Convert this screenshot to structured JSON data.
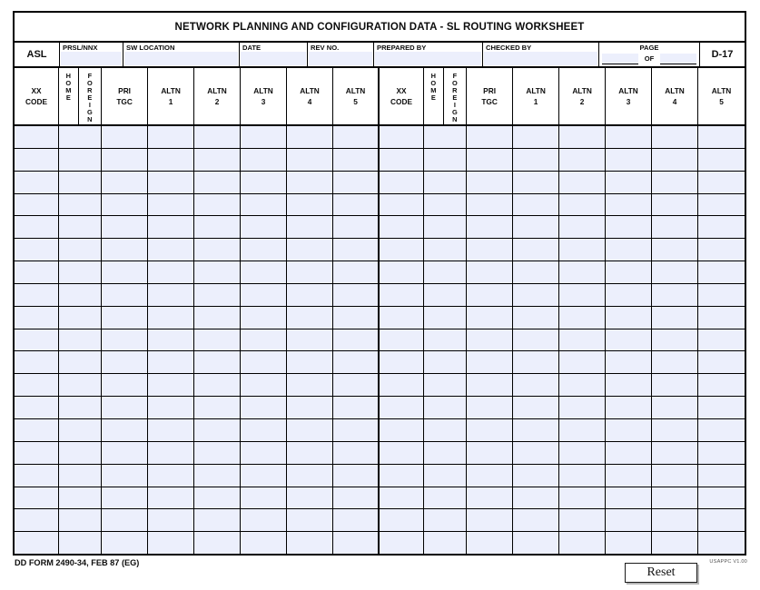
{
  "document": {
    "title": "NETWORK PLANNING AND CONFIGURATION DATA - SL ROUTING WORKSHEET",
    "form_id": "DD FORM 2490-34, FEB 87 (EG)",
    "agency_version": "USAPPC V1.00",
    "page_ref": "D-17"
  },
  "meta": {
    "asl_label": "ASL",
    "prsl_label": "PRSL/NNX",
    "sw_location_label": "SW LOCATION",
    "date_label": "DATE",
    "rev_no_label": "REV NO.",
    "prepared_by_label": "PREPARED BY",
    "checked_by_label": "CHECKED BY",
    "page_label": "PAGE",
    "of_label": "OF",
    "values": {
      "prsl": "",
      "sw_location": "",
      "date": "",
      "rev_no": "",
      "prepared_by": "",
      "checked_by": "",
      "page": "",
      "of": ""
    }
  },
  "table": {
    "row_count": 19,
    "groups": [
      {
        "name": "left-group",
        "columns": [
          {
            "key": "xx_code",
            "label": "XX\nCODE",
            "orientation": "horizontal"
          },
          {
            "key": "home",
            "label": "HOME",
            "orientation": "vertical"
          },
          {
            "key": "foreign",
            "label": "FOREIGN",
            "orientation": "vertical"
          },
          {
            "key": "pri_tgc",
            "label": "PRI\nTGC",
            "orientation": "horizontal"
          },
          {
            "key": "altn_1",
            "label": "ALTN\n1",
            "orientation": "horizontal"
          },
          {
            "key": "altn_2",
            "label": "ALTN\n2",
            "orientation": "horizontal"
          },
          {
            "key": "altn_3",
            "label": "ALTN\n3",
            "orientation": "horizontal"
          },
          {
            "key": "altn_4",
            "label": "ALTN\n4",
            "orientation": "horizontal"
          },
          {
            "key": "altn_5",
            "label": "ALTN\n5",
            "orientation": "horizontal"
          }
        ]
      },
      {
        "name": "right-group",
        "columns": [
          {
            "key": "xx_code",
            "label": "XX\nCODE",
            "orientation": "horizontal"
          },
          {
            "key": "home",
            "label": "HOME",
            "orientation": "vertical"
          },
          {
            "key": "foreign",
            "label": "FOREIGN",
            "orientation": "vertical"
          },
          {
            "key": "pri_tgc",
            "label": "PRI\nTGC",
            "orientation": "horizontal"
          },
          {
            "key": "altn_1",
            "label": "ALTN\n1",
            "orientation": "horizontal"
          },
          {
            "key": "altn_2",
            "label": "ALTN\n2",
            "orientation": "horizontal"
          },
          {
            "key": "altn_3",
            "label": "ALTN\n3",
            "orientation": "horizontal"
          },
          {
            "key": "altn_4",
            "label": "ALTN\n4",
            "orientation": "horizontal"
          },
          {
            "key": "altn_5",
            "label": "ALTN\n5",
            "orientation": "horizontal"
          }
        ]
      }
    ],
    "rows": []
  },
  "actions": {
    "reset_label": "Reset"
  },
  "colors": {
    "field_fill": "#eceffc",
    "border": "#000000",
    "text": "#0d0d0d"
  }
}
